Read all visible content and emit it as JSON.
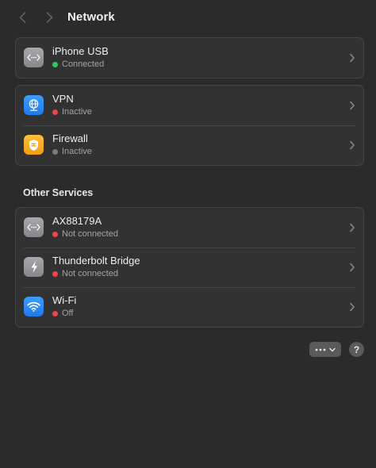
{
  "header": {
    "title": "Network",
    "back_icon": "chevron-left-icon",
    "forward_icon": "chevron-right-icon"
  },
  "colors": {
    "connected": "#32c759",
    "inactive_red": "#e5484d",
    "inactive_grey": "#7a7a7a"
  },
  "group1": {
    "items": [
      {
        "name": "iPhone USB",
        "status": "Connected",
        "icon": "ethernet-icon",
        "status_color": "green"
      }
    ]
  },
  "group2": {
    "items": [
      {
        "name": "VPN",
        "status": "Inactive",
        "icon": "vpn-globe-icon",
        "status_color": "red"
      },
      {
        "name": "Firewall",
        "status": "Inactive",
        "icon": "firewall-shield-icon",
        "status_color": "grey"
      }
    ]
  },
  "other_services": {
    "title": "Other Services",
    "items": [
      {
        "name": "AX88179A",
        "status": "Not connected",
        "icon": "ethernet-icon",
        "status_color": "red"
      },
      {
        "name": "Thunderbolt Bridge",
        "status": "Not connected",
        "icon": "thunderbolt-icon",
        "status_color": "red"
      },
      {
        "name": "Wi-Fi",
        "status": "Off",
        "icon": "wifi-icon",
        "status_color": "red"
      }
    ]
  },
  "footer": {
    "more_icon": "ellipsis-icon",
    "help_label": "?"
  }
}
